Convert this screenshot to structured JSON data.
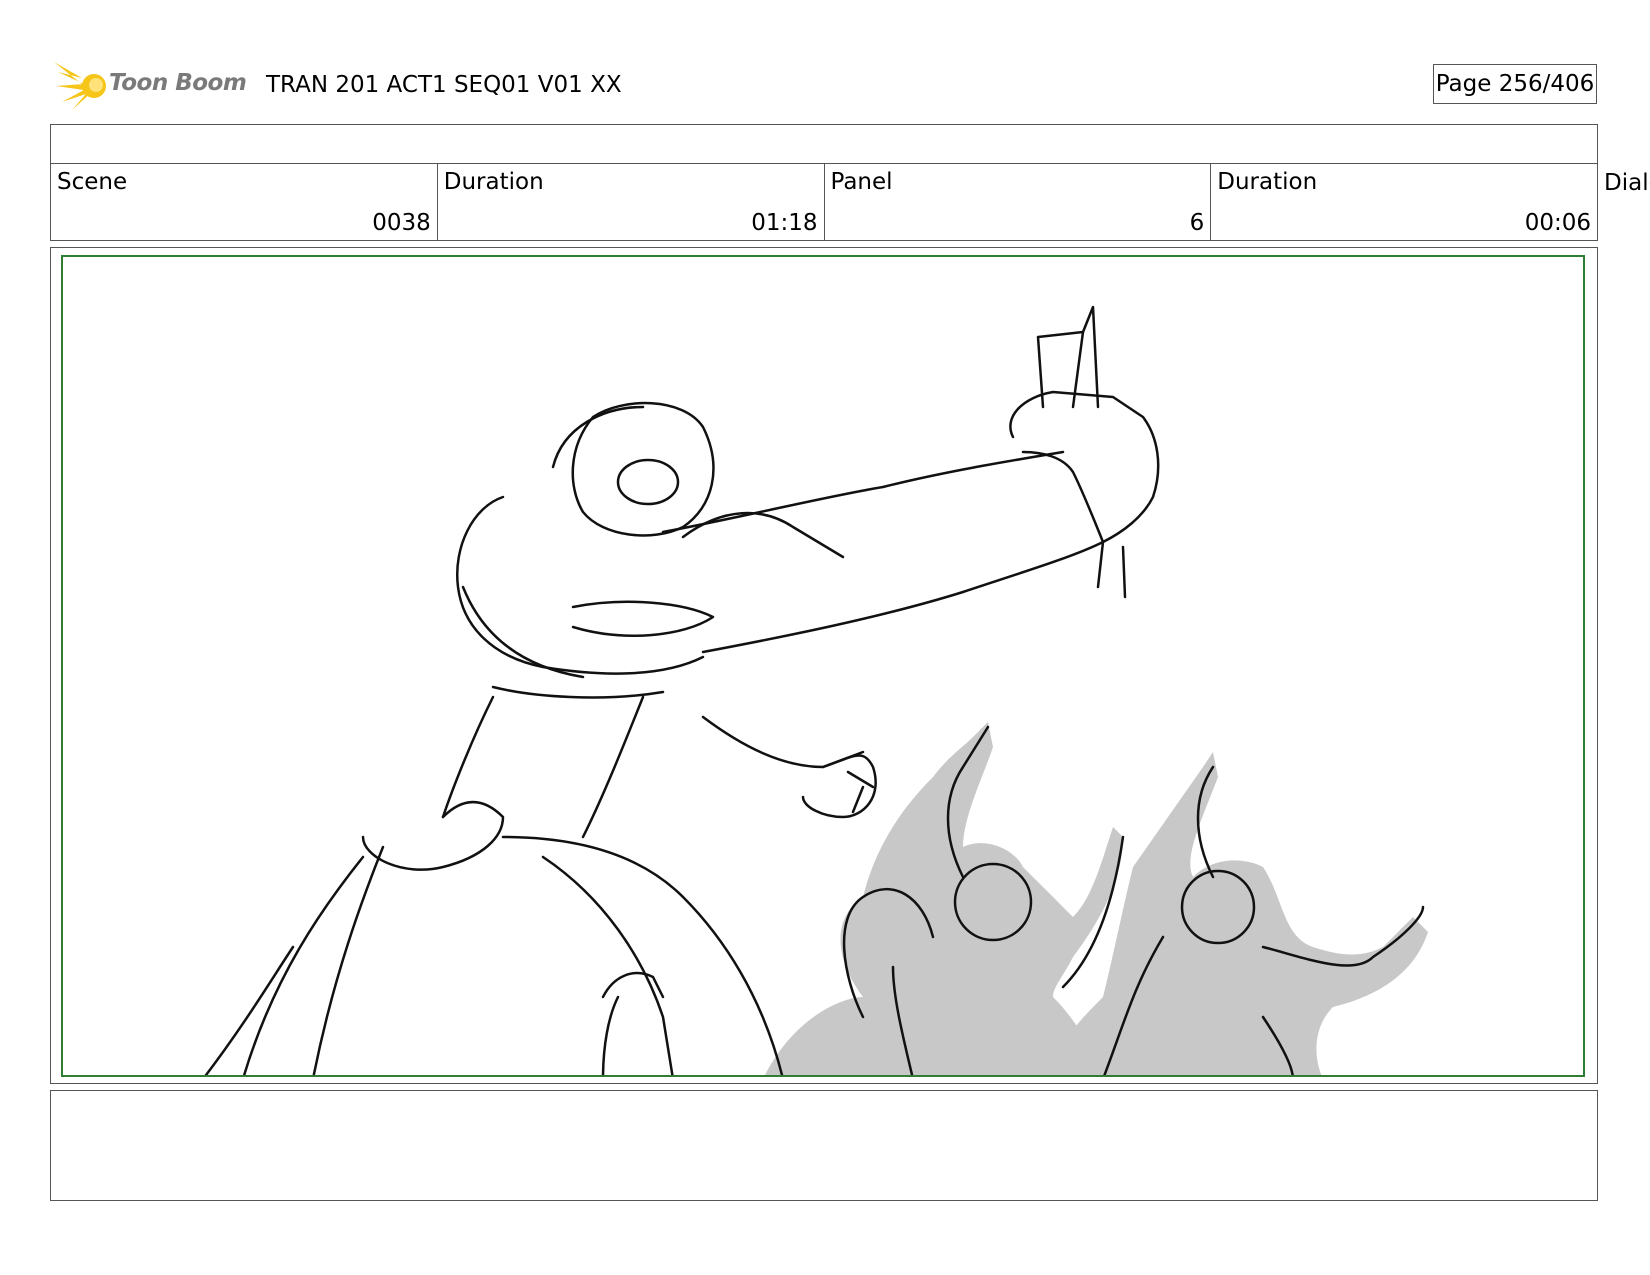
{
  "header": {
    "logo_text": "Toon Boom",
    "doc_title": "TRAN 201 ACT1 SEQ01 V01 XX",
    "page": "Page 256/406"
  },
  "info": {
    "scene_label": "Scene",
    "scene_value": "0038",
    "scene_duration_label": "Duration",
    "scene_duration_value": "01:18",
    "panel_label": "Panel",
    "panel_value": "6",
    "panel_duration_label": "Duration",
    "panel_duration_value": "00:06",
    "dialog_label": "Dialo"
  },
  "colors": {
    "frame_border": "#2e7d32",
    "logo_accent": "#f5c518",
    "sketch_fill": "#c8c8c8"
  }
}
